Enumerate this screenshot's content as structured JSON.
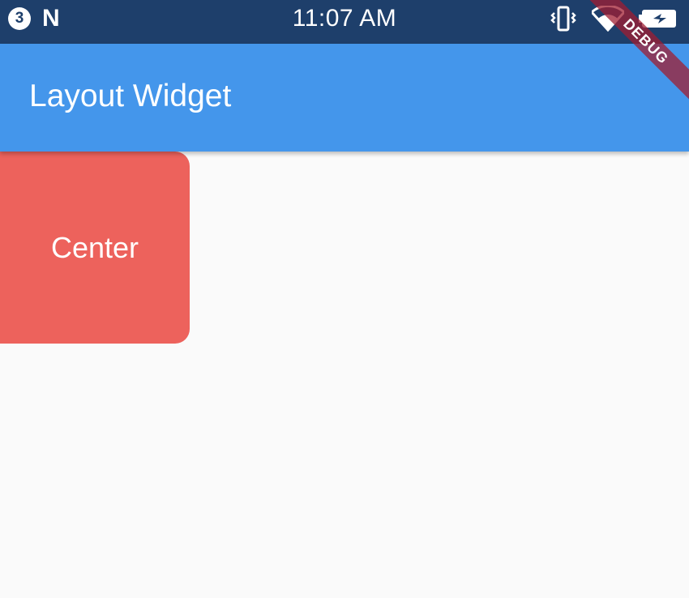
{
  "status_bar": {
    "notification_count": "3",
    "n_icon_text": "N",
    "time": "11:07 AM",
    "icons": [
      "vibrate-icon",
      "wifi-icon",
      "battery-charging-icon"
    ]
  },
  "app_bar": {
    "title": "Layout Widget"
  },
  "debug_banner": {
    "label": "DEBUG"
  },
  "content": {
    "box_label": "Center"
  },
  "colors": {
    "status_bar": "#1e3f6b",
    "app_bar": "#4496eb",
    "box": "#ed625c",
    "background": "#fafafa"
  }
}
